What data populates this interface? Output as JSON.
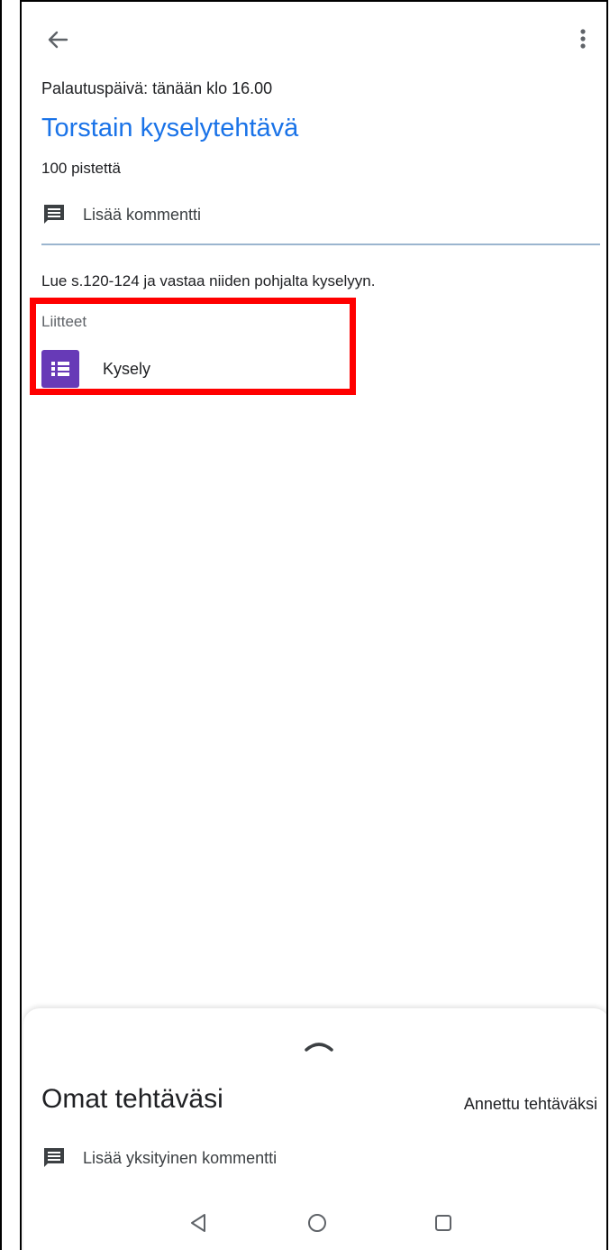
{
  "assignment": {
    "due_text": "Palautuspäivä: tänään klo 16.00",
    "title": "Torstain kyselytehtävä",
    "points": "100 pistettä",
    "add_comment": "Lisää kommentti",
    "instructions": "Lue s.120-124 ja vastaa niiden pohjalta kyselyyn."
  },
  "attachments": {
    "heading": "Liitteet",
    "items": [
      {
        "name": "Kysely",
        "icon": "google-forms-icon"
      }
    ]
  },
  "your_work": {
    "title": "Omat tehtäväsi",
    "status": "Annettu tehtäväksi",
    "private_comment": "Lisää yksityinen kommentti"
  },
  "icons": {
    "back": "arrow-back-icon",
    "more": "more-vert-icon",
    "comment": "comment-icon",
    "expand": "chevron-up-icon",
    "nav_back": "triangle-back-icon",
    "nav_home": "circle-home-icon",
    "nav_recents": "square-recents-icon"
  },
  "colors": {
    "title": "#1a73e8",
    "forms": "#673ab7",
    "highlight": "#ff0000"
  }
}
